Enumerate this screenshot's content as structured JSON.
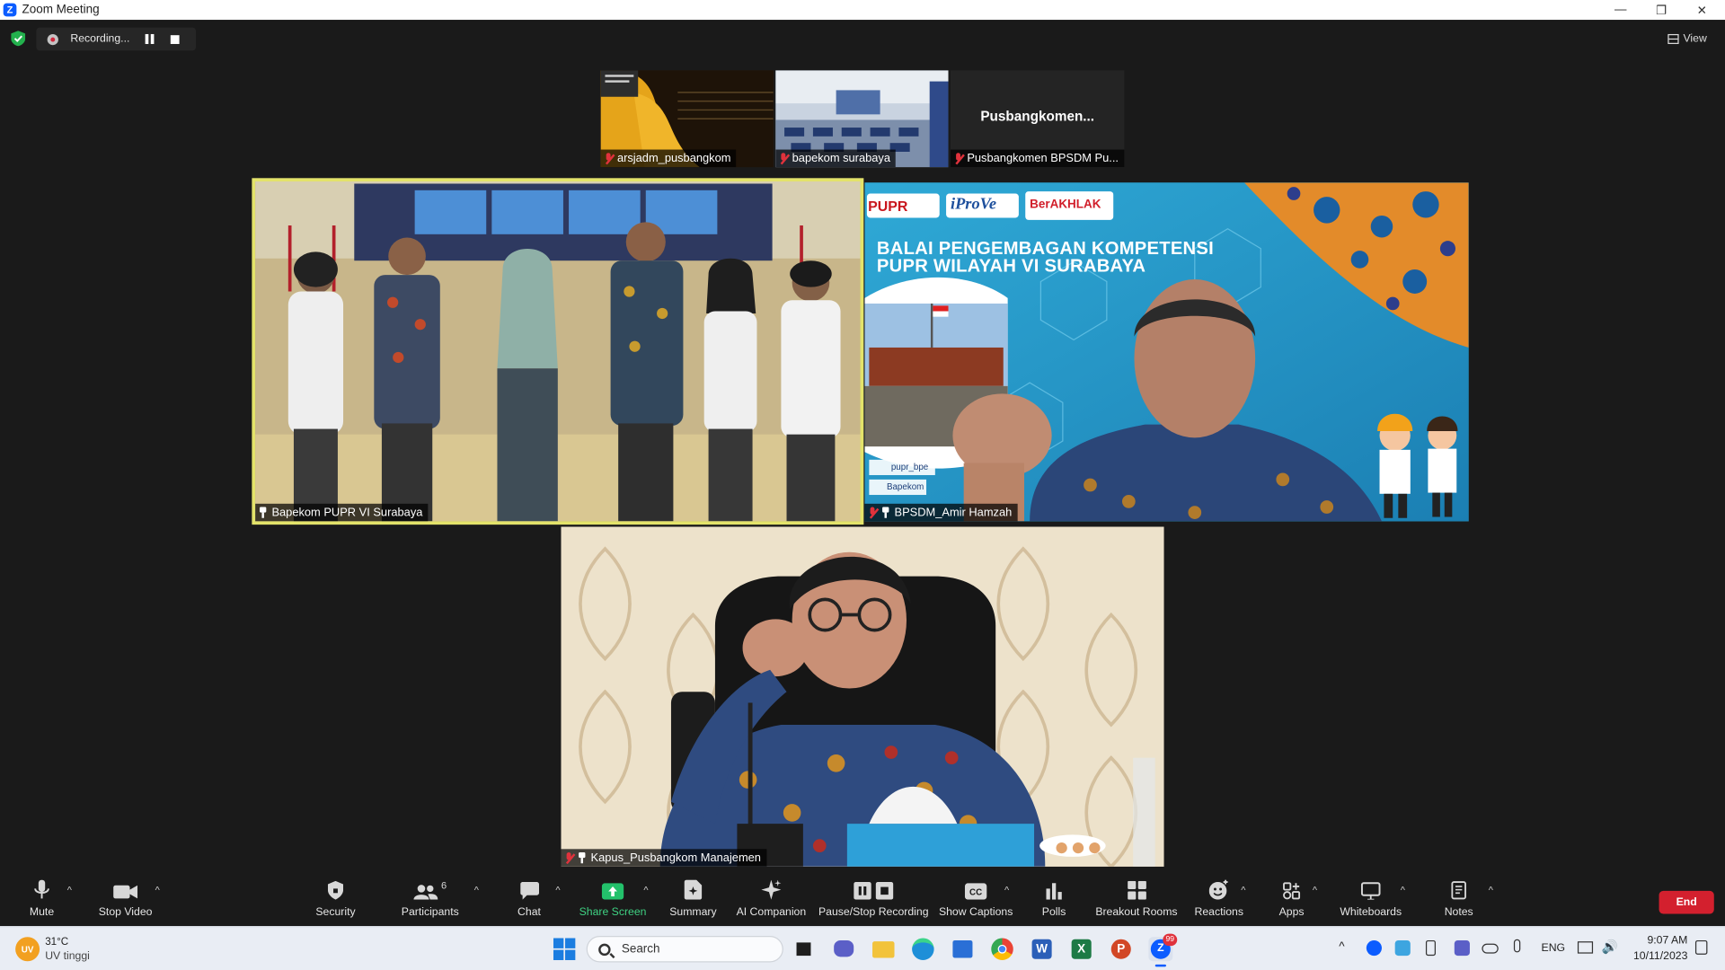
{
  "window": {
    "title": "Zoom Meeting",
    "app_icon": "zoom-logo-icon"
  },
  "window_controls": {
    "minimize": "—",
    "restore": "❐",
    "close": "✕"
  },
  "recording": {
    "status": "Recording..."
  },
  "view_button": {
    "label": "View"
  },
  "thumbnails": [
    {
      "name": "arsjadm_pusbangkom",
      "muted": true
    },
    {
      "name": "bapekom surabaya",
      "muted": true
    },
    {
      "name": "Pusbangkomen BPSDM Pu...",
      "muted": true,
      "display_name_big": "Pusbangkomen..."
    }
  ],
  "videos": {
    "group": {
      "name": "Bapekom PUPR VI Surabaya",
      "pinned": true,
      "active_speaker": true
    },
    "presenter": {
      "name": "BPSDM_Amir Hamzah",
      "pinned": true,
      "muted": true,
      "banner_line1": "BALAI PENGEMBAGAN KOMPETENSI",
      "banner_line2": "PUPR WILAYAH VI SURABAYA",
      "logo_pupr": "PUPR",
      "logo_iprove": "iProVe",
      "logo_berakhlak": "BerAKHLAK",
      "social": "pupr_bpe",
      "social2": "Bapekom"
    },
    "main": {
      "name": "Kapus_Pusbangkom Manajemen",
      "pinned": true,
      "muted": true
    }
  },
  "toolbar": {
    "mute": "Mute",
    "stop_video": "Stop Video",
    "security": "Security",
    "participants": "Participants",
    "participants_count": "6",
    "chat": "Chat",
    "share_screen": "Share Screen",
    "summary": "Summary",
    "ai_companion": "AI Companion",
    "pause_stop_recording": "Pause/Stop Recording",
    "show_captions": "Show Captions",
    "polls": "Polls",
    "breakout_rooms": "Breakout Rooms",
    "reactions": "Reactions",
    "apps": "Apps",
    "whiteboards": "Whiteboards",
    "notes": "Notes",
    "end": "End"
  },
  "taskbar": {
    "weather_temp": "31°C",
    "weather_desc": "UV tinggi",
    "weather_badge": "UV",
    "search_placeholder": "Search",
    "zoom_badge": "99",
    "lang": "ENG",
    "time": "9:07 AM",
    "date": "10/11/2023"
  },
  "colors": {
    "active_speaker_border": "#e3e36a",
    "share_green": "#23c16b",
    "end_red": "#d3202e",
    "zoom_blue": "#0b5cff"
  }
}
